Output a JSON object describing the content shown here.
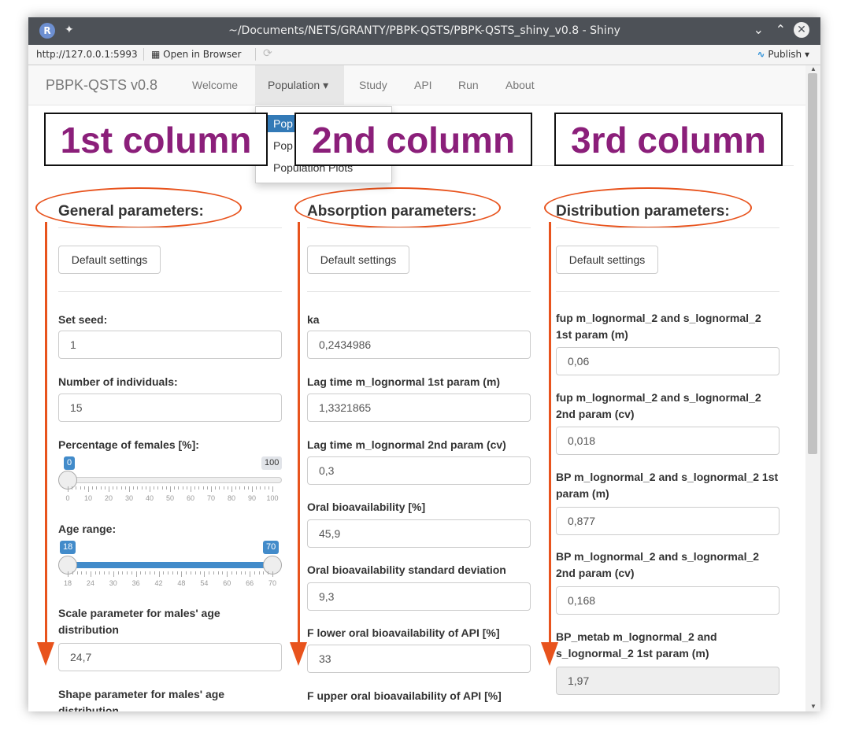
{
  "window": {
    "title": "~/Documents/NETS/GRANTY/PBPK-QSTS/PBPK-QSTS_shiny_v0.8 - Shiny",
    "r_logo": "R",
    "pin_icon": "pin-icon",
    "url": "http://127.0.0.1:5993",
    "open_in_browser": "Open in Browser",
    "publish": "Publish"
  },
  "navbar": {
    "brand": "PBPK-QSTS v0.8",
    "tabs": [
      "Welcome",
      "Population",
      "Study",
      "API",
      "Run",
      "About"
    ],
    "active_tab": "Population",
    "dropdown_items": [
      "Pop",
      "Pop",
      "Population Plots"
    ]
  },
  "annotations": {
    "col1": "1st column",
    "col2": "2nd column",
    "col3": "3rd column",
    "accent": "#e8531d",
    "label_color": "#8b1f7a"
  },
  "col1": {
    "header": "General parameters:",
    "default_btn": "Default settings",
    "seed_label": "Set seed:",
    "seed_value": "1",
    "nind_label": "Number of individuals:",
    "nind_value": "15",
    "females_label": "Percentage of females [%]:",
    "females_value": "0",
    "females_max": "100",
    "females_ticks": [
      "0",
      "10",
      "20",
      "30",
      "40",
      "50",
      "60",
      "70",
      "80",
      "90",
      "100"
    ],
    "age_label": "Age range:",
    "age_min": "18",
    "age_max": "70",
    "age_ticks": [
      "18",
      "24",
      "30",
      "36",
      "42",
      "48",
      "54",
      "60",
      "66",
      "70"
    ],
    "scale_label": "Scale parameter for males' age distribution",
    "scale_value": "24,7",
    "shape_label": "Shape parameter for males' age distribution"
  },
  "col2": {
    "header": "Absorption parameters:",
    "default_btn": "Default settings",
    "fields": [
      {
        "label": "ka",
        "value": "0,2434986"
      },
      {
        "label": "Lag time m_lognormal 1st param (m)",
        "value": "1,3321865"
      },
      {
        "label": "Lag time m_lognormal 2nd param (cv)",
        "value": "0,3"
      },
      {
        "label": "Oral bioavailability [%]",
        "value": "45,9"
      },
      {
        "label": "Oral bioavailability standard deviation",
        "value": "9,3"
      },
      {
        "label": "F lower oral bioavailability of API [%]",
        "value": "33"
      }
    ],
    "last_label": "F upper oral bioavailability of API [%]"
  },
  "col3": {
    "header": "Distribution parameters:",
    "default_btn": "Default settings",
    "fields": [
      {
        "label": "fup m_lognormal_2 and s_lognormal_2 1st param (m)",
        "value": "0,06"
      },
      {
        "label": "fup m_lognormal_2 and s_lognormal_2 2nd param (cv)",
        "value": "0,018"
      },
      {
        "label": "BP m_lognormal_2 and s_lognormal_2 1st param (m)",
        "value": "0,877"
      },
      {
        "label": "BP m_lognormal_2 and s_lognormal_2 2nd param (cv)",
        "value": "0,168"
      },
      {
        "label": "BP_metab m_lognormal_2 and s_lognormal_2 1st param (m)",
        "value": "1,97"
      }
    ]
  }
}
